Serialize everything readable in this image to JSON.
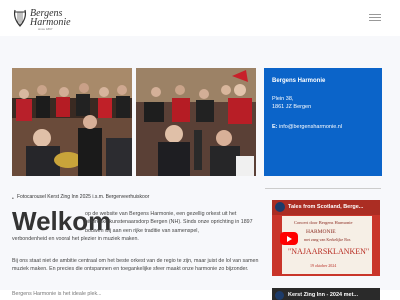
{
  "header": {
    "logo_line1": "Bergens",
    "logo_line2": "Harmonie",
    "logo_line3": "since 1897"
  },
  "gallery": {
    "caption": "Fotocarousel Kerst Zing Inn 2025 i.s.m. Bergerveerhuiskoor"
  },
  "main": {
    "heading": "Welkom",
    "intro_part1": "op de website van Bergens Harmonie, een gezellig orkest uit het pittoreske kunstenaarsdorp Bergen (NH). Sinds onze oprichting in 1897 bouwen wij aan een rijke traditie van samenspel,",
    "intro_part2": "verbondenheid en vooral het plezier in muziek maken.",
    "intro_para2": "Bij ons staat niet de ambitie centraal om het beste orkest van de regio te zijn, maar juist de lol van samen muziek maken. En precies die ontspannen en toegankelijke sfeer maakt onze harmonie zo bijzonder.",
    "intro_para3": "Bergens Harmonie is het ideale plek..."
  },
  "contact": {
    "title": "Bergens Harmonie",
    "address_line1": "Plein 38,",
    "address_line2": "1861 JZ Bergen",
    "email_label": "E:",
    "email": "info@bergensharmonie.nl"
  },
  "video1": {
    "title": "Tales from Scotland, Berge...",
    "line1": "Concert door Bergens Harmonie",
    "line2": "HARMONIE",
    "line3": "met zang van Kerkelijke Bos",
    "line4": "\"NAJAARSKLANKEN\"",
    "line5": "19 oktober 2024"
  },
  "video2": {
    "title": "Kerst Zing Inn - 2024 met..."
  },
  "colors": {
    "accent": "#0b64c9",
    "video_bg": "#c9352a"
  }
}
